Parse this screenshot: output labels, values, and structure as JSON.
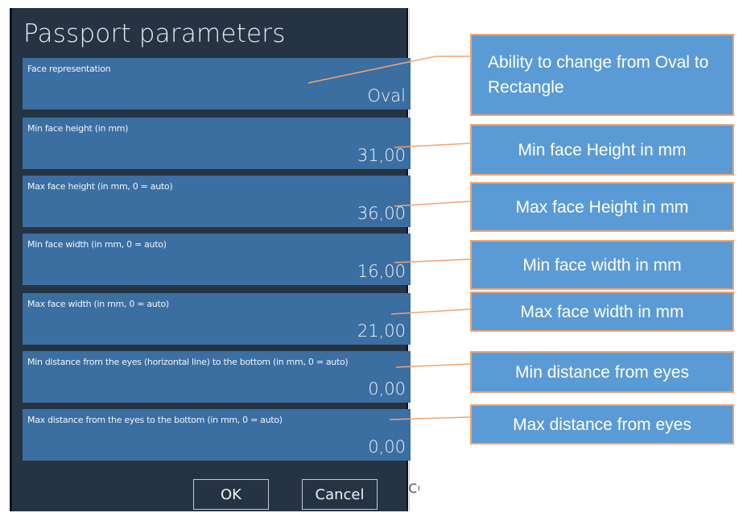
{
  "dialog": {
    "title": "Passport parameters",
    "fields": [
      {
        "label": "Face representation",
        "value": "Oval"
      },
      {
        "label": "Min face height (in mm)",
        "value": "31,00"
      },
      {
        "label": "Max face height (in mm, 0 = auto)",
        "value": "36,00"
      },
      {
        "label": "Min face width (in mm, 0 = auto)",
        "value": "16,00"
      },
      {
        "label": "Max face width (in mm, 0 = auto)",
        "value": "21,00"
      },
      {
        "label": "Min distance from the eyes (horizontal line) to the bottom (in mm, 0 = auto)",
        "value": "0,00"
      },
      {
        "label": "Max distance from the eyes to the bottom (in mm, 0 = auto)",
        "value": "0,00"
      }
    ],
    "ok_label": "OK",
    "cancel_label": "Cancel",
    "background_partial_text": "ce"
  },
  "callouts": [
    {
      "text": "Ability to change from Oval to Rectangle"
    },
    {
      "text": "Min face Height in mm"
    },
    {
      "text": "Max face Height in mm"
    },
    {
      "text": "Min face width in mm"
    },
    {
      "text": "Max face width  in mm"
    },
    {
      "text": "Min distance from eyes"
    },
    {
      "text": "Max distance from eyes"
    }
  ],
  "colors": {
    "dialog_background": "#253343",
    "field_background": "#3b6ea1",
    "callout_fill": "#5b9bd5",
    "callout_border": "#f3a46e",
    "connector": "#f3a46e"
  }
}
